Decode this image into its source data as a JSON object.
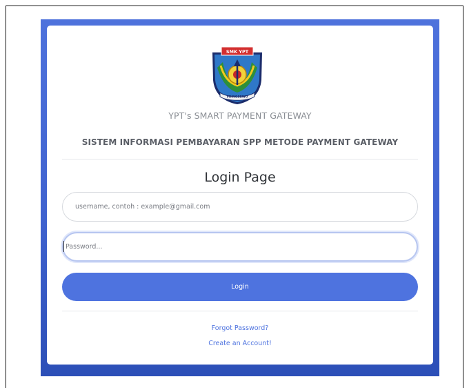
{
  "subtitle": "YPT's SMART PAYMENT GATEWAY",
  "system_title": "SISTEM INFORMASI PEMBAYARAN SPP METODE PAYMENT GATEWAY",
  "logo_banner_text": "SMK YPT",
  "logo_ribbon_text": "PRINGSEWU",
  "heading": "Login Page",
  "form": {
    "username_placeholder": "username, contoh : example@gmail.com",
    "password_placeholder": "Password...",
    "login_label": "Login"
  },
  "links": {
    "forgot": "Forgot Password?",
    "create": "Create an Account!"
  },
  "colors": {
    "accent": "#4e73df",
    "background_panel": "#4e72dc"
  }
}
